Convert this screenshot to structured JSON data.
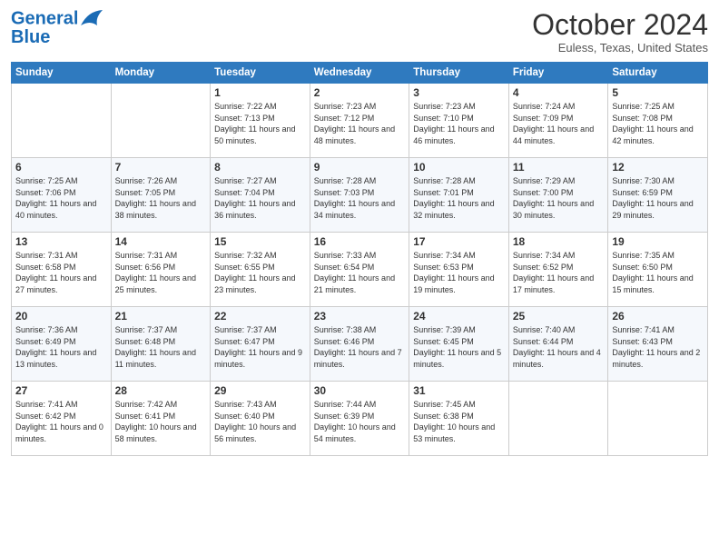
{
  "header": {
    "logo_line1": "General",
    "logo_line2": "Blue",
    "month": "October 2024",
    "location": "Euless, Texas, United States"
  },
  "days_of_week": [
    "Sunday",
    "Monday",
    "Tuesday",
    "Wednesday",
    "Thursday",
    "Friday",
    "Saturday"
  ],
  "weeks": [
    [
      {
        "day": "",
        "info": ""
      },
      {
        "day": "",
        "info": ""
      },
      {
        "day": "1",
        "info": "Sunrise: 7:22 AM\nSunset: 7:13 PM\nDaylight: 11 hours and 50 minutes."
      },
      {
        "day": "2",
        "info": "Sunrise: 7:23 AM\nSunset: 7:12 PM\nDaylight: 11 hours and 48 minutes."
      },
      {
        "day": "3",
        "info": "Sunrise: 7:23 AM\nSunset: 7:10 PM\nDaylight: 11 hours and 46 minutes."
      },
      {
        "day": "4",
        "info": "Sunrise: 7:24 AM\nSunset: 7:09 PM\nDaylight: 11 hours and 44 minutes."
      },
      {
        "day": "5",
        "info": "Sunrise: 7:25 AM\nSunset: 7:08 PM\nDaylight: 11 hours and 42 minutes."
      }
    ],
    [
      {
        "day": "6",
        "info": "Sunrise: 7:25 AM\nSunset: 7:06 PM\nDaylight: 11 hours and 40 minutes."
      },
      {
        "day": "7",
        "info": "Sunrise: 7:26 AM\nSunset: 7:05 PM\nDaylight: 11 hours and 38 minutes."
      },
      {
        "day": "8",
        "info": "Sunrise: 7:27 AM\nSunset: 7:04 PM\nDaylight: 11 hours and 36 minutes."
      },
      {
        "day": "9",
        "info": "Sunrise: 7:28 AM\nSunset: 7:03 PM\nDaylight: 11 hours and 34 minutes."
      },
      {
        "day": "10",
        "info": "Sunrise: 7:28 AM\nSunset: 7:01 PM\nDaylight: 11 hours and 32 minutes."
      },
      {
        "day": "11",
        "info": "Sunrise: 7:29 AM\nSunset: 7:00 PM\nDaylight: 11 hours and 30 minutes."
      },
      {
        "day": "12",
        "info": "Sunrise: 7:30 AM\nSunset: 6:59 PM\nDaylight: 11 hours and 29 minutes."
      }
    ],
    [
      {
        "day": "13",
        "info": "Sunrise: 7:31 AM\nSunset: 6:58 PM\nDaylight: 11 hours and 27 minutes."
      },
      {
        "day": "14",
        "info": "Sunrise: 7:31 AM\nSunset: 6:56 PM\nDaylight: 11 hours and 25 minutes."
      },
      {
        "day": "15",
        "info": "Sunrise: 7:32 AM\nSunset: 6:55 PM\nDaylight: 11 hours and 23 minutes."
      },
      {
        "day": "16",
        "info": "Sunrise: 7:33 AM\nSunset: 6:54 PM\nDaylight: 11 hours and 21 minutes."
      },
      {
        "day": "17",
        "info": "Sunrise: 7:34 AM\nSunset: 6:53 PM\nDaylight: 11 hours and 19 minutes."
      },
      {
        "day": "18",
        "info": "Sunrise: 7:34 AM\nSunset: 6:52 PM\nDaylight: 11 hours and 17 minutes."
      },
      {
        "day": "19",
        "info": "Sunrise: 7:35 AM\nSunset: 6:50 PM\nDaylight: 11 hours and 15 minutes."
      }
    ],
    [
      {
        "day": "20",
        "info": "Sunrise: 7:36 AM\nSunset: 6:49 PM\nDaylight: 11 hours and 13 minutes."
      },
      {
        "day": "21",
        "info": "Sunrise: 7:37 AM\nSunset: 6:48 PM\nDaylight: 11 hours and 11 minutes."
      },
      {
        "day": "22",
        "info": "Sunrise: 7:37 AM\nSunset: 6:47 PM\nDaylight: 11 hours and 9 minutes."
      },
      {
        "day": "23",
        "info": "Sunrise: 7:38 AM\nSunset: 6:46 PM\nDaylight: 11 hours and 7 minutes."
      },
      {
        "day": "24",
        "info": "Sunrise: 7:39 AM\nSunset: 6:45 PM\nDaylight: 11 hours and 5 minutes."
      },
      {
        "day": "25",
        "info": "Sunrise: 7:40 AM\nSunset: 6:44 PM\nDaylight: 11 hours and 4 minutes."
      },
      {
        "day": "26",
        "info": "Sunrise: 7:41 AM\nSunset: 6:43 PM\nDaylight: 11 hours and 2 minutes."
      }
    ],
    [
      {
        "day": "27",
        "info": "Sunrise: 7:41 AM\nSunset: 6:42 PM\nDaylight: 11 hours and 0 minutes."
      },
      {
        "day": "28",
        "info": "Sunrise: 7:42 AM\nSunset: 6:41 PM\nDaylight: 10 hours and 58 minutes."
      },
      {
        "day": "29",
        "info": "Sunrise: 7:43 AM\nSunset: 6:40 PM\nDaylight: 10 hours and 56 minutes."
      },
      {
        "day": "30",
        "info": "Sunrise: 7:44 AM\nSunset: 6:39 PM\nDaylight: 10 hours and 54 minutes."
      },
      {
        "day": "31",
        "info": "Sunrise: 7:45 AM\nSunset: 6:38 PM\nDaylight: 10 hours and 53 minutes."
      },
      {
        "day": "",
        "info": ""
      },
      {
        "day": "",
        "info": ""
      }
    ]
  ]
}
